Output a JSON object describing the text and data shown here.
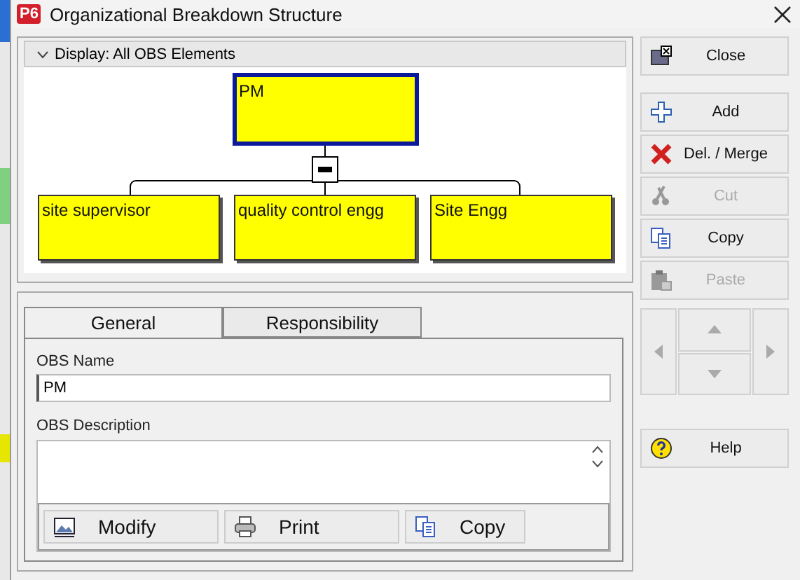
{
  "window": {
    "title": "Organizational Breakdown Structure",
    "app_badge": "P6"
  },
  "chart_panel": {
    "display_label": "Display: All OBS Elements",
    "expanded": true
  },
  "obs_tree": {
    "name": "PM",
    "selected": true,
    "expanded": true,
    "children": [
      {
        "name": "site supervisor",
        "selected": false
      },
      {
        "name": "quality control engg",
        "selected": false
      },
      {
        "name": "Site Engg",
        "selected": false
      }
    ]
  },
  "tabs": [
    {
      "label": "General",
      "selected": true
    },
    {
      "label": "Responsibility",
      "selected": false
    }
  ],
  "form": {
    "name_label": "OBS Name",
    "name_value": "PM",
    "description_label": "OBS Description"
  },
  "description_toolbar": [
    "Modify",
    "Print",
    "Copy"
  ],
  "side_buttons": [
    {
      "label": "Close",
      "disabled": false
    },
    {
      "label": "Add",
      "disabled": false
    },
    {
      "label": "Del. / Merge",
      "disabled": false
    },
    {
      "label": "Cut",
      "disabled": true
    },
    {
      "label": "Copy",
      "disabled": false
    },
    {
      "label": "Paste",
      "disabled": true
    }
  ],
  "navigation": {
    "disabled": true
  },
  "help_button": {
    "label": "Help",
    "disabled": false
  }
}
